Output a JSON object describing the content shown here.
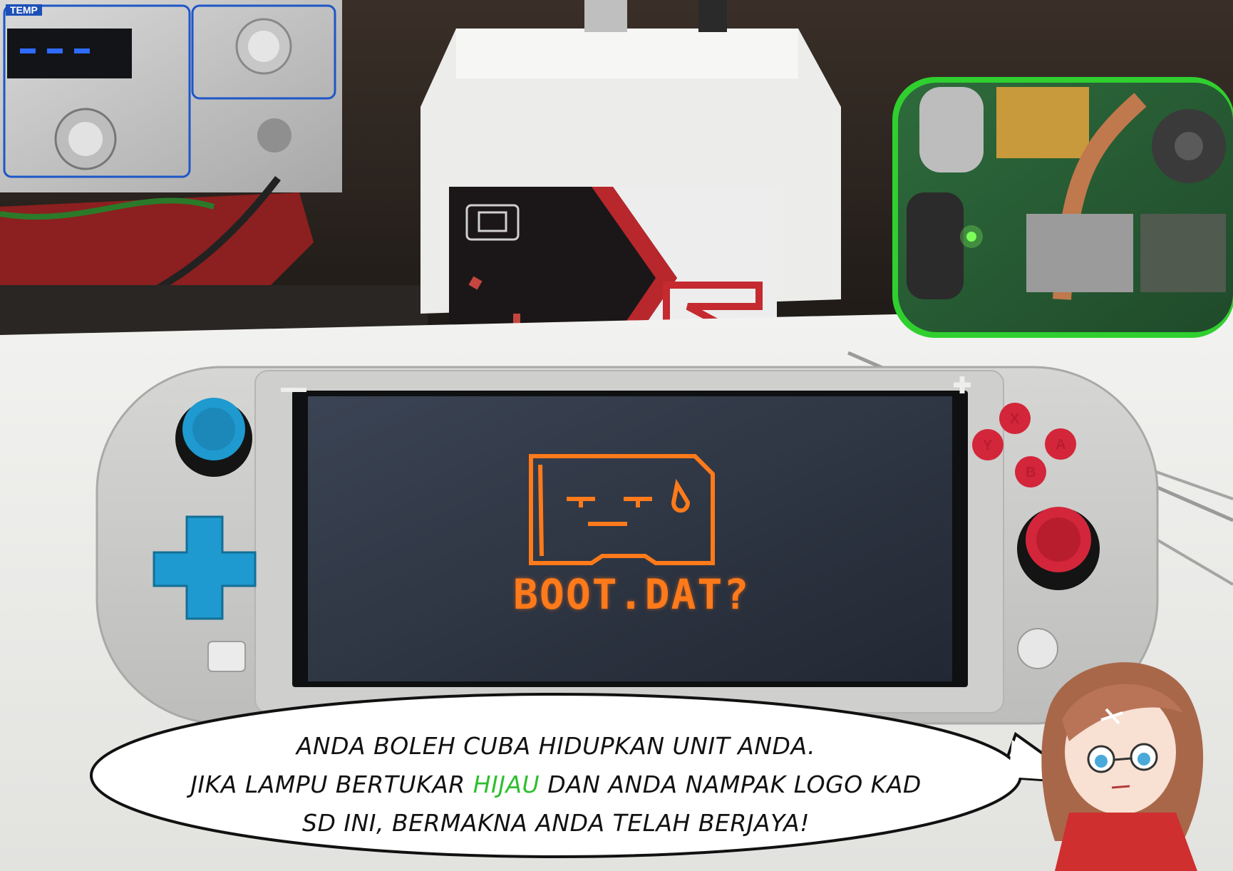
{
  "equipment": {
    "temp_label": "TEMP"
  },
  "console": {
    "screen_message": "BOOT.DAT?",
    "buttons": [
      "X",
      "Y",
      "A",
      "B"
    ]
  },
  "speech_bubble": {
    "line1": "ANDA BOLEH CUBA HIDUPKAN UNIT ANDA.",
    "line2_before": "JIKA LAMPU BERTUKAR ",
    "line2_highlight": "HIJAU",
    "line2_after": " DAN ANDA NAMPAK LOGO KAD",
    "line3": "SD INI, BERMAKNA ANDA TELAH BERJAYA!"
  },
  "colors": {
    "highlight_green": "#2fbf2f",
    "screen_orange": "#ff7a1a",
    "console_body": "#c9c9c7",
    "accent_blue": "#1e9ad0",
    "accent_red": "#d3263a"
  }
}
